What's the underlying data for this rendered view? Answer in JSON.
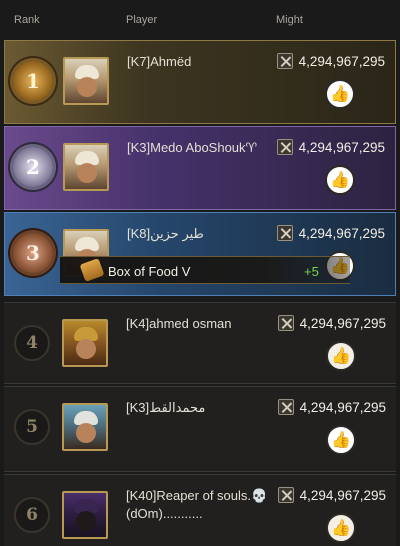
{
  "header": {
    "rank": "Rank",
    "player": "Player",
    "might": "Might"
  },
  "rows": [
    {
      "rank": "1",
      "name": "[K7]Ahmëd",
      "might": "4,294,967,295",
      "medal": "gold",
      "avatar_icon": "turban-avatar-icon"
    },
    {
      "rank": "2",
      "name": "[K3]Medo AboShouk♈",
      "might": "4,294,967,295",
      "medal": "silver",
      "avatar_icon": "turban-avatar-icon"
    },
    {
      "rank": "3",
      "name": "[K8]طير حزين",
      "might": "4,294,967,295",
      "medal": "bronze",
      "avatar_icon": "turban-avatar-icon"
    },
    {
      "rank": "4",
      "name": "[K4]ahmed osman",
      "might": "4,294,967,295",
      "medal": "plain",
      "avatar_icon": "warrior-avatar-icon"
    },
    {
      "rank": "5",
      "name": "[K3]محمدالقط",
      "might": "4,294,967,295",
      "medal": "plain",
      "avatar_icon": "headband-avatar-icon"
    },
    {
      "rank": "6",
      "name": "[K40]Reaper of souls.💀 (dOm)...........",
      "might": "4,294,967,295",
      "medal": "plain",
      "avatar_icon": "masked-avatar-icon"
    }
  ],
  "tooltip": {
    "label": "Box of Food V",
    "gain": "+5"
  },
  "colors": {
    "gold_row": "#6b5a32",
    "silver_row": "#6a4a8c",
    "bronze_row": "#3a6494",
    "plus_green": "#7ed24a"
  },
  "icons": {
    "might": "crossed-swords-icon",
    "like": "thumbs-up-icon",
    "tooltip": "food-box-icon"
  }
}
